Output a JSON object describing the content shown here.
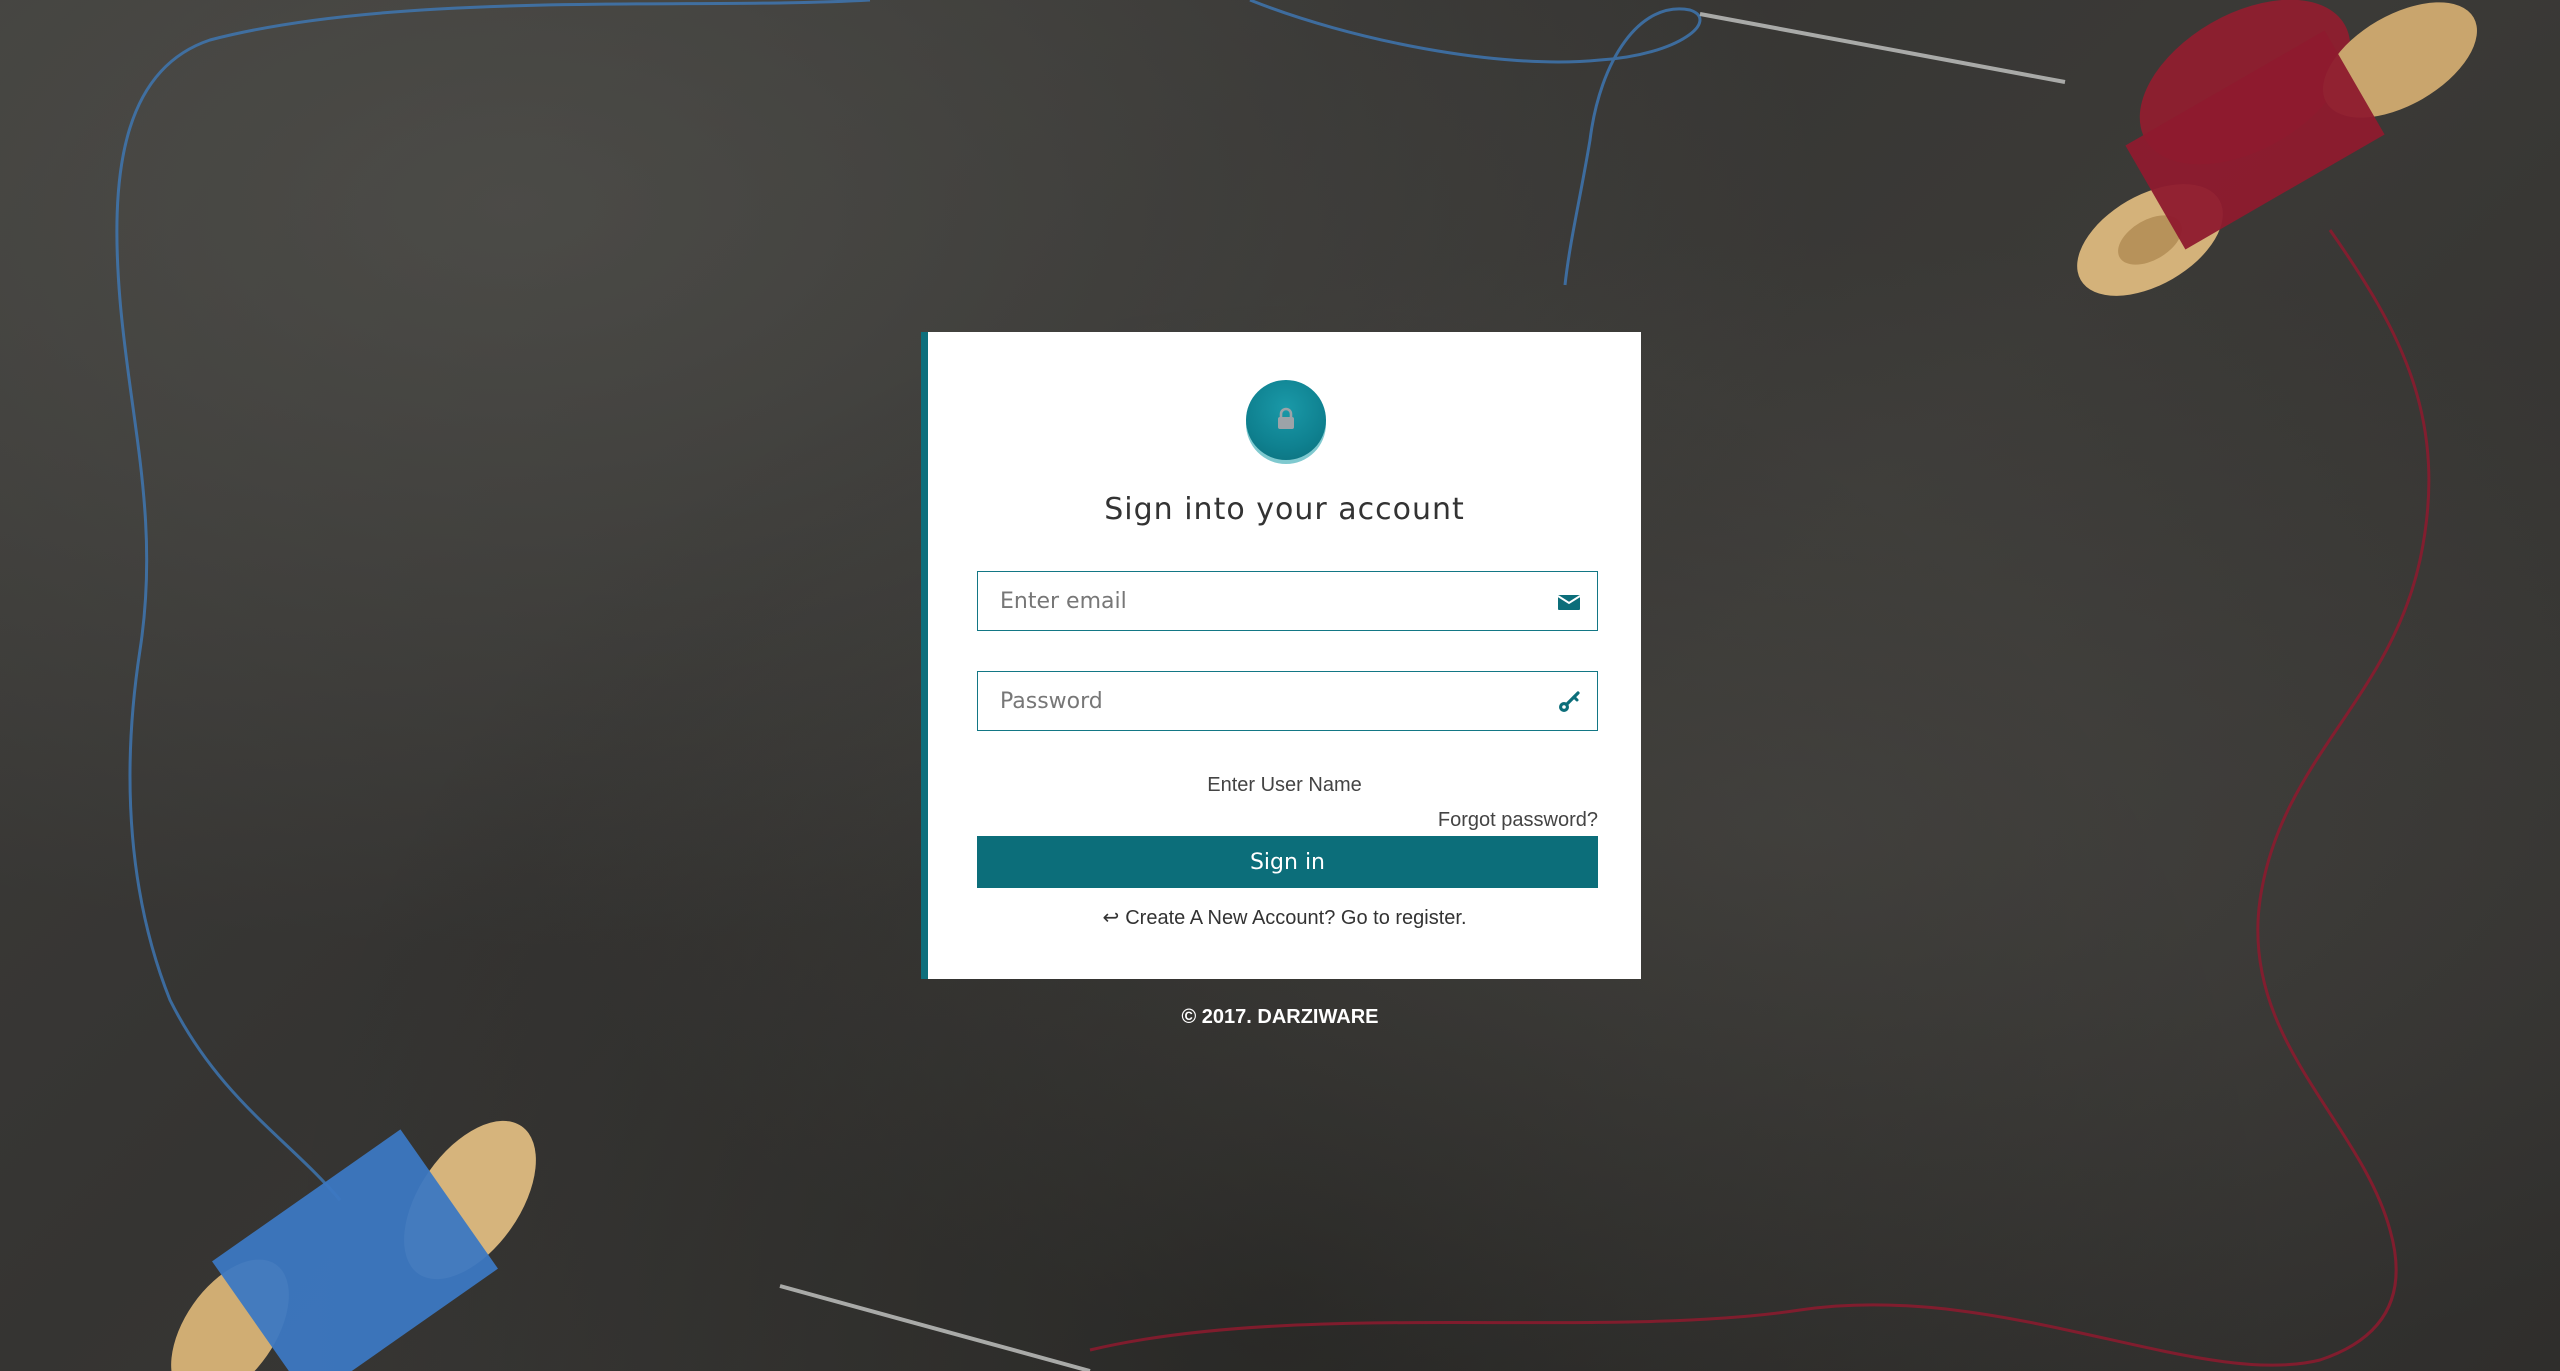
{
  "login": {
    "title": "Sign into your account",
    "email_placeholder": "Enter email",
    "password_placeholder": "Password",
    "hint": "Enter User Name",
    "forgot_password": "Forgot password?",
    "sign_in": "Sign in",
    "register_prompt": "Create A New Account? Go to register.",
    "register_icon": "reply-arrow-icon",
    "email_icon": "envelope-icon",
    "password_icon": "key-icon",
    "header_icon": "lock-icon"
  },
  "footer": {
    "copyright": "© 2017. DARZIWARE"
  },
  "colors": {
    "accent": "#0c6e7a",
    "badge": "#0f8190",
    "badge_shadow": "#7fc9cf",
    "background": "#3a3937",
    "blue_thread": "#3f79b8",
    "red_thread": "#8e1a2e"
  }
}
